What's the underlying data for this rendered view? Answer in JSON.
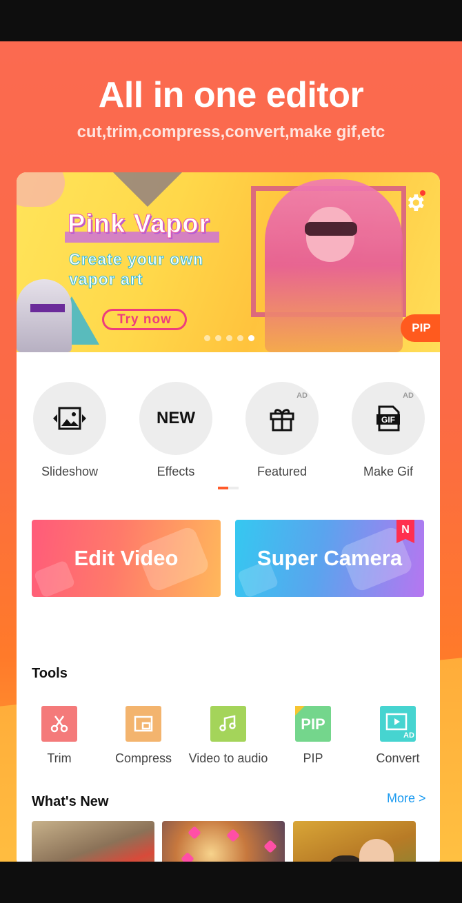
{
  "hero": {
    "title": "All in one editor",
    "subtitle": "cut,trim,compress,convert,make gif,etc"
  },
  "banner": {
    "title": "Pink Vapor",
    "subtitle": "Create your own vapor art",
    "cta": "Try now",
    "pip_label": "PIP",
    "settings_icon": "gear-icon",
    "carousel_total": 5,
    "carousel_active": 5
  },
  "quick_actions": [
    {
      "label": "Slideshow",
      "icon": "image-slideshow-icon",
      "ad": ""
    },
    {
      "label": "Effects",
      "icon_text": "NEW",
      "ad": ""
    },
    {
      "label": "Featured",
      "icon": "gift-icon",
      "ad": "AD"
    },
    {
      "label": "Make Gif",
      "icon": "gif-icon",
      "ad": "AD"
    }
  ],
  "big_buttons": {
    "edit_video": "Edit Video",
    "super_camera": "Super Camera",
    "super_camera_badge": "N"
  },
  "tools": {
    "title": "Tools",
    "items": [
      {
        "label": "Trim",
        "icon": "scissors-icon",
        "color": "#f47a7a"
      },
      {
        "label": "Compress",
        "icon": "compress-icon",
        "color": "#f3b46e"
      },
      {
        "label": "Video to audio",
        "icon": "music-icon",
        "color": "#a4d45a"
      },
      {
        "label": "PIP",
        "icon": "pip-icon",
        "icon_text": "PIP",
        "color": "#74d68c"
      },
      {
        "label": "Convert",
        "icon": "convert-icon",
        "icon_badge": "AD",
        "color": "#46d4d0"
      }
    ]
  },
  "whats_new": {
    "title": "What's New",
    "more": "More >"
  },
  "colors": {
    "accent": "#ff5a2a",
    "link": "#1a9af0"
  }
}
